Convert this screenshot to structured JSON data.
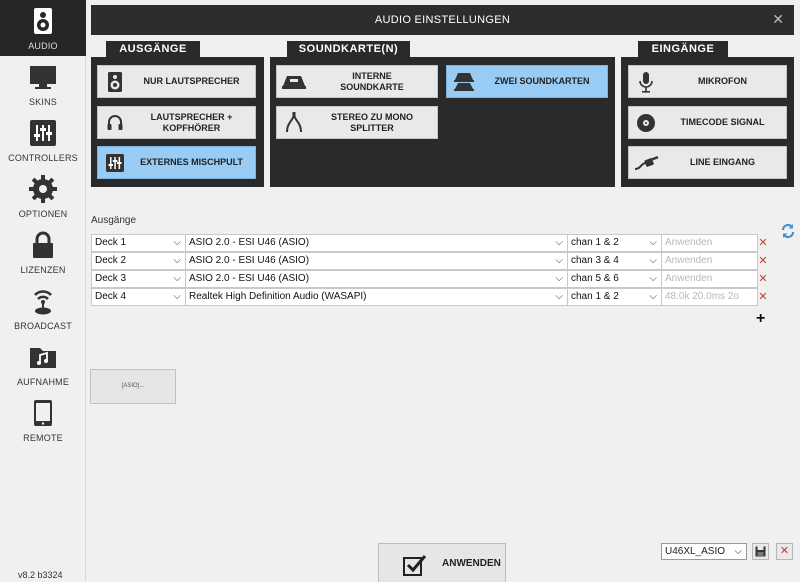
{
  "sidebar": {
    "items": [
      {
        "label": "AUDIO",
        "icon": "speaker-icon",
        "active": true
      },
      {
        "label": "SKINS",
        "icon": "monitor-icon"
      },
      {
        "label": "CONTROLLERS",
        "icon": "sliders-icon"
      },
      {
        "label": "OPTIONEN",
        "icon": "gear-icon"
      },
      {
        "label": "LIZENZEN",
        "icon": "lock-icon"
      },
      {
        "label": "BROADCAST",
        "icon": "broadcast-icon"
      },
      {
        "label": "AUFNAHME",
        "icon": "music-folder-icon"
      },
      {
        "label": "REMOTE",
        "icon": "tablet-icon"
      }
    ],
    "version": "v8.2 b3324"
  },
  "header": {
    "title": "AUDIO EINSTELLUNGEN",
    "close": "✕"
  },
  "panels": {
    "ausgaenge": {
      "title": "AUSGÄNGE",
      "options": [
        {
          "label": "NUR LAUTSPRECHER",
          "icon": "speaker-icon"
        },
        {
          "label": "LAUTSPRECHER +\nKOPFHÖRER",
          "icon": "headphones-icon"
        },
        {
          "label": "EXTERNES MISCHPULT",
          "icon": "mixer-icon",
          "selected": true
        }
      ]
    },
    "soundkarte": {
      "title": "SOUNDKARTE(N)",
      "options": [
        {
          "label": "INTERNE\nSOUNDKARTE",
          "icon": "soundcard-icon"
        },
        {
          "label": "ZWEI SOUNDKARTEN",
          "icon": "dual-soundcard-icon",
          "selected": true
        },
        {
          "label": "STEREO ZU MONO\nSPLITTER",
          "icon": "splitter-cable-icon"
        }
      ]
    },
    "eingaenge": {
      "title": "EINGÄNGE",
      "options": [
        {
          "label": "MIKROFON",
          "icon": "microphone-icon"
        },
        {
          "label": "TIMECODE SIGNAL",
          "icon": "vinyl-icon"
        },
        {
          "label": "LINE EINGANG",
          "icon": "line-cable-icon"
        }
      ]
    }
  },
  "outputs": {
    "section_label": "Ausgänge",
    "rows": [
      {
        "deck": "Deck 1",
        "device": "ASIO 2.0 - ESI U46 (ASIO)",
        "channels": "chan 1 & 2",
        "info": "Anwenden"
      },
      {
        "deck": "Deck 2",
        "device": "ASIO 2.0 - ESI U46 (ASIO)",
        "channels": "chan 3 & 4",
        "info": "Anwenden"
      },
      {
        "deck": "Deck 3",
        "device": "ASIO 2.0 - ESI U46 (ASIO)",
        "channels": "chan 5 & 6",
        "info": "Anwenden"
      },
      {
        "deck": "Deck 4",
        "device": "Realtek High Definition Audio (WASAPI)",
        "channels": "chan 1 & 2",
        "info": "48.0k 20.0ms 2o"
      }
    ],
    "add": "+",
    "delete": "✕",
    "dropdown": "⌵"
  },
  "asio_button": "[ASIO]...",
  "footer": {
    "apply_label": "ANWENDEN",
    "preset_value": "U46XL_ASIO"
  },
  "colors": {
    "selected": "#99ccf4",
    "panel": "#2a2a2a",
    "header": "#2d2d2d",
    "delete": "#c43c3c"
  }
}
